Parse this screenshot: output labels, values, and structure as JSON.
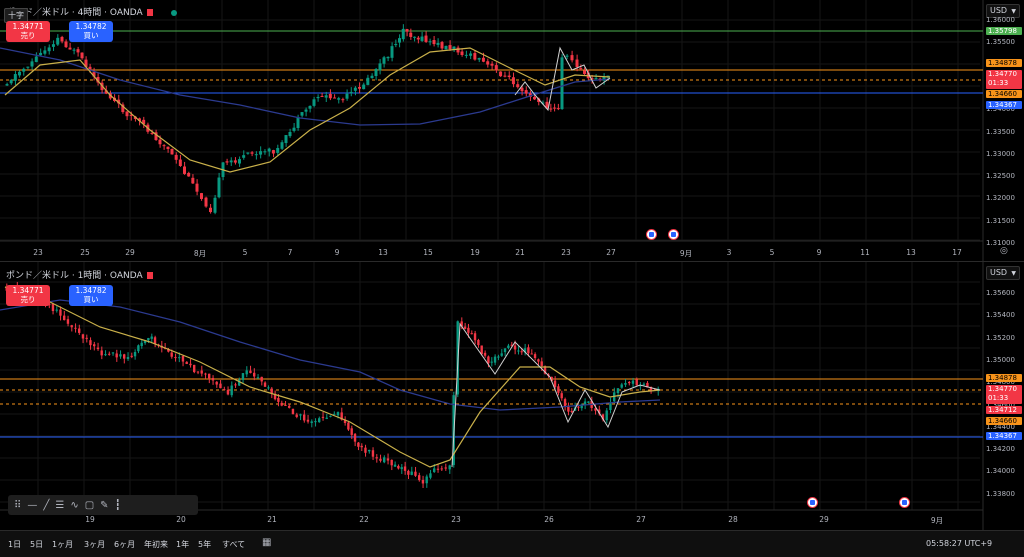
{
  "colors": {
    "up": "#089981",
    "down": "#f23645",
    "ma_fast": "#c9b04a",
    "ma_slow": "#2b3a8f",
    "level_orange": "#f7931a",
    "level_blue": "#2962ff",
    "level_green": "#4caf50"
  },
  "top_pane": {
    "title": "ポンド／米ドル · 4時間 · OANDA",
    "crosshair_label": "十字",
    "sell": {
      "price": "1.34771",
      "label": "売り"
    },
    "buy": {
      "price": "1.34782",
      "label": "買い"
    },
    "currency": "USD",
    "price_ticks": [
      "1.36000",
      "1.35500",
      "1.35000",
      "1.34500",
      "1.34000",
      "1.33500",
      "1.33000",
      "1.32500",
      "1.32000",
      "1.31500",
      "1.31000"
    ],
    "badges": {
      "green": "1.35798",
      "orange": "1.34878",
      "current": "1.34770",
      "countdown": "01:33",
      "orange2": "1.34660",
      "blue": "1.34367"
    },
    "x_ticks": [
      "23",
      "25",
      "29",
      "8月",
      "5",
      "7",
      "9",
      "13",
      "15",
      "19",
      "21",
      "23",
      "27",
      "9月",
      "3",
      "5",
      "9",
      "11",
      "13",
      "17"
    ]
  },
  "bottom_pane": {
    "title": "ポンド／米ドル · 1時間 · OANDA",
    "sell": {
      "price": "1.34771",
      "label": "売り"
    },
    "buy": {
      "price": "1.34782",
      "label": "買い"
    },
    "currency": "USD",
    "price_ticks": [
      "1.35600",
      "1.35400",
      "1.35200",
      "1.35000",
      "1.34800",
      "1.34600",
      "1.34400",
      "1.34200",
      "1.34000",
      "1.33800"
    ],
    "badges": {
      "orange": "1.34878",
      "current": "1.34770",
      "countdown": "01:33",
      "red": "1.34712",
      "orange2": "1.34660",
      "blue": "1.34367"
    },
    "x_ticks": [
      "19",
      "20",
      "21",
      "22",
      "23",
      "26",
      "27",
      "28",
      "29",
      "9月"
    ]
  },
  "toolbar_icons": [
    "grip-icon",
    "horizontal-line-icon",
    "trend-line-icon",
    "fib-icon",
    "path-icon",
    "rectangle-icon",
    "brush-icon",
    "indicators-icon"
  ],
  "bottom_bar": {
    "ranges": [
      "1日",
      "5日",
      "1ヶ月",
      "3ヶ月",
      "6ヶ月",
      "年初来",
      "1年",
      "5年",
      "すべて"
    ],
    "clock": "05:58:27 UTC+9"
  }
}
